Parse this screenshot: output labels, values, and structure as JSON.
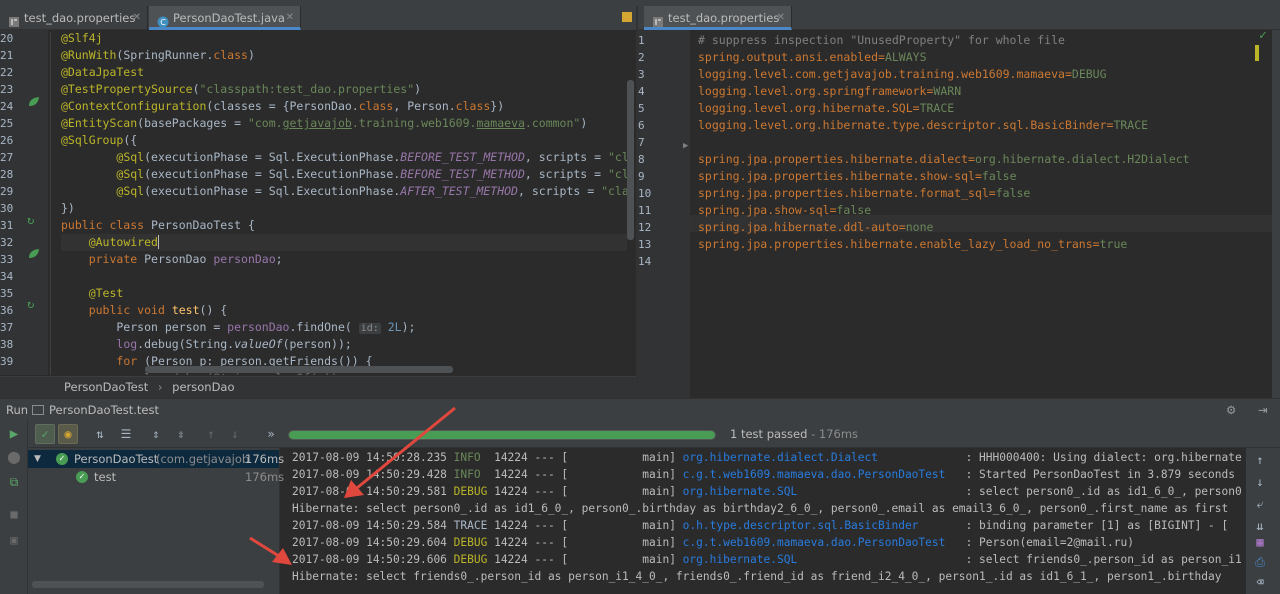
{
  "left_tabs": [
    {
      "label": "test_dao.properties",
      "active": false
    },
    {
      "label": "PersonDaoTest.java",
      "active": true
    }
  ],
  "right_tabs": [
    {
      "label": "test_dao.properties",
      "active": true
    }
  ],
  "java_editor": {
    "line_numbers": [
      "20",
      "21",
      "22",
      "23",
      "24",
      "25",
      "26",
      "27",
      "28",
      "29",
      "30",
      "31",
      "32",
      "33",
      "34",
      "35",
      "36",
      "37",
      "38",
      "39"
    ],
    "breadcrumb": [
      "PersonDaoTest",
      "personDao"
    ]
  },
  "props_editor": {
    "line_numbers": [
      "1",
      "2",
      "3",
      "4",
      "5",
      "6",
      "7",
      "8",
      "9",
      "10",
      "11",
      "12",
      "13",
      "14"
    ],
    "lines": [
      {
        "key": "",
        "val": "",
        "comment": "# suppress inspection \"UnusedProperty\" for whole file"
      },
      {
        "key": "spring.output.ansi.enabled",
        "val": "ALWAYS"
      },
      {
        "key": "logging.level.com.getjavajob.training.web1609.mamaeva",
        "val": "DEBUG"
      },
      {
        "key": "logging.level.org.springframework",
        "val": "WARN"
      },
      {
        "key": "logging.level.org.hibernate.SQL",
        "val": "TRACE"
      },
      {
        "key": "logging.level.org.hibernate.type.descriptor.sql.BasicBinder",
        "val": "TRACE"
      },
      {
        "key": "",
        "val": ""
      },
      {
        "key": "spring.jpa.properties.hibernate.dialect",
        "val": "org.hibernate.dialect.H2Dialect"
      },
      {
        "key": "spring.jpa.properties.hibernate.show-sql",
        "val": "false"
      },
      {
        "key": "spring.jpa.properties.hibernate.format_sql",
        "val": "false"
      },
      {
        "key": "spring.jpa.show-sql",
        "val": "false"
      },
      {
        "key": "spring.jpa.hibernate.ddl-auto",
        "val": "none"
      },
      {
        "key": "spring.jpa.properties.hibernate.enable_lazy_load_no_trans",
        "val": "true"
      },
      {
        "key": "",
        "val": ""
      }
    ]
  },
  "run_panel": {
    "run_label": "Run",
    "config_name": "PersonDaoTest.test",
    "status": "1 test passed",
    "status_time": "- 176ms",
    "progress": 1.0,
    "tree": [
      {
        "label": "PersonDaoTest",
        "sub": "(com.getjavajob",
        "time": "176ms"
      },
      {
        "label": "test",
        "sub": "",
        "time": "176ms"
      }
    ]
  },
  "console": [
    {
      "ts": "2017-08-09 14:50:28.235",
      "lvl": "INFO ",
      "pid": "14224",
      "thread": "[           main]",
      "logger": "org.hibernate.dialect.Dialect            ",
      "msg": ": HHH000400: Using dialect: org.hibernate"
    },
    {
      "ts": "2017-08-09 14:50:29.428",
      "lvl": "INFO ",
      "pid": "14224",
      "thread": "[           main]",
      "logger": "c.g.t.web1609.mamaeva.dao.PersonDaoTest  ",
      "msg": ": Started PersonDaoTest in 3.879 seconds"
    },
    {
      "ts": "2017-08-09 14:50:29.581",
      "lvl": "DEBUG",
      "pid": "14224",
      "thread": "[           main]",
      "logger": "org.hibernate.SQL                        ",
      "msg": ": select person0_.id as id1_6_0_, person0"
    },
    {
      "raw": "Hibernate: select person0_.id as id1_6_0_, person0_.birthday as birthday2_6_0_, person0_.email as email3_6_0_, person0_.first_name as first"
    },
    {
      "ts": "2017-08-09 14:50:29.584",
      "lvl": "TRACE",
      "pid": "14224",
      "thread": "[           main]",
      "logger": "o.h.type.descriptor.sql.BasicBinder      ",
      "msg": ": binding parameter [1] as [BIGINT] - ["
    },
    {
      "ts": "2017-08-09 14:50:29.604",
      "lvl": "DEBUG",
      "pid": "14224",
      "thread": "[           main]",
      "logger": "c.g.t.web1609.mamaeva.dao.PersonDaoTest  ",
      "msg": ": Person(email=2@mail.ru)"
    },
    {
      "ts": "2017-08-09 14:50:29.606",
      "lvl": "DEBUG",
      "pid": "14224",
      "thread": "[           main]",
      "logger": "org.hibernate.SQL                        ",
      "msg": ": select friends0_.person_id as person_i1"
    },
    {
      "raw": "Hibernate: select friends0_.person_id as person_i1_4_0_, friends0_.friend_id as friend_i2_4_0_, person1_.id as id1_6_1_, person1_.birthday"
    }
  ],
  "colors": {
    "accent": "#4a88c7",
    "success": "#499c54",
    "arrow": "#e0483e"
  }
}
